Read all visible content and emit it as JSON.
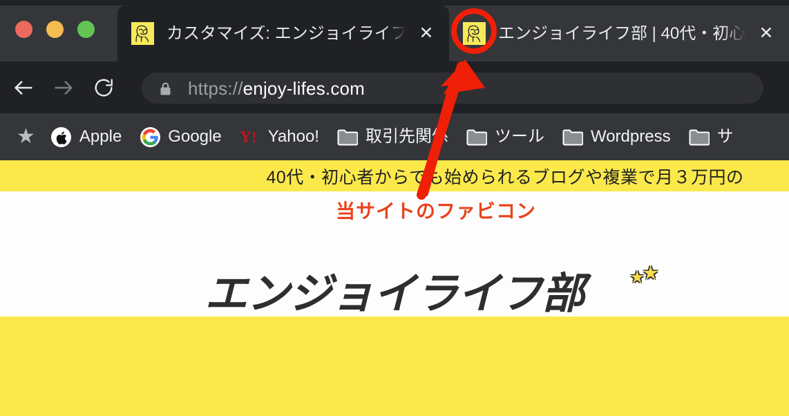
{
  "window": {
    "traffic_lights": [
      {
        "name": "close",
        "color": "#ec6a5e"
      },
      {
        "name": "minimize",
        "color": "#f5bd4f"
      },
      {
        "name": "maximize",
        "color": "#62c554"
      }
    ]
  },
  "tabs": [
    {
      "title": "カスタマイズ: エンジョイライフ部",
      "favicon": "site-favicon-face",
      "close_label": "✕",
      "active": true
    },
    {
      "title": "エンジョイライフ部 | 40代・初心",
      "favicon": "site-favicon-face",
      "close_label": "✕",
      "active": false
    }
  ],
  "toolbar": {
    "back_label": "back-arrow-icon",
    "forward_label": "forward-arrow-icon",
    "reload_label": "reload-icon",
    "lock_label": "lock-icon",
    "url_scheme": "https://",
    "url_host": "enjoy-lifes.com",
    "url_full": "https://enjoy-lifes.com"
  },
  "bookmarks": {
    "star_glyph": "★",
    "items": [
      {
        "label": "Apple",
        "icon": "apple-logo-icon"
      },
      {
        "label": "Google",
        "icon": "google-g-icon"
      },
      {
        "label": "Yahoo!",
        "icon": "yahoo-y-icon"
      },
      {
        "label": "取引先関係",
        "icon": "folder-icon"
      },
      {
        "label": "ツール",
        "icon": "folder-icon"
      },
      {
        "label": "Wordpress",
        "icon": "folder-icon"
      },
      {
        "label": "サ",
        "icon": "folder-icon"
      }
    ]
  },
  "page": {
    "banner_text": "40代・初心者からでも始められるブログや複業で月３万円の",
    "logo_text": "エンジョイライフ部",
    "banner_bg": "#fbe94b",
    "hero_bg": "#fbe94b",
    "content_bg": "#fdfdfd"
  },
  "annotations": {
    "callout_text": "当サイトのファビコン",
    "callout_color": "#e8441d",
    "circle_color": "#f01f07",
    "arrow_color": "#f01f07"
  }
}
